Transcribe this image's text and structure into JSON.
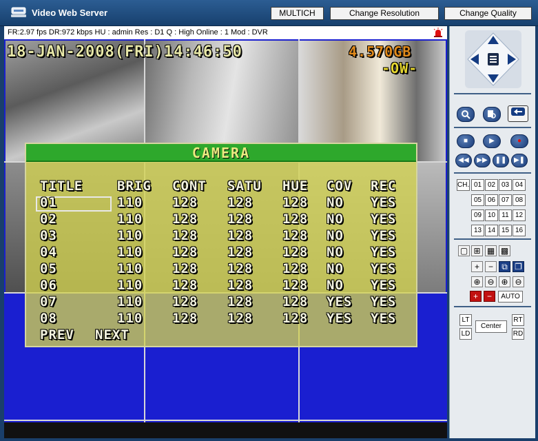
{
  "app": {
    "title": "Video Web Server"
  },
  "toolbar": {
    "multich_label": "MULTICH",
    "resolution_label": "Change Resolution",
    "quality_label": "Change Quality"
  },
  "status": {
    "text": "FR:2.97 fps  DR:972 kbps  HU : admin  Res : D1  Q : High  Online : 1 Mod : DVR"
  },
  "osd": {
    "datetime": "18-JAN-2008(FRI)14:46:50",
    "disk": "4.570GB",
    "mode": "-OW-"
  },
  "camera_menu": {
    "title": "CAMERA",
    "headers": [
      "TITLE",
      "BRIG",
      "CONT",
      "SATU",
      "HUE",
      "COV",
      "REC"
    ],
    "rows": [
      [
        "01",
        "110",
        "128",
        "128",
        "128",
        "NO",
        "YES"
      ],
      [
        "02",
        "110",
        "128",
        "128",
        "128",
        "NO",
        "YES"
      ],
      [
        "03",
        "110",
        "128",
        "128",
        "128",
        "NO",
        "YES"
      ],
      [
        "04",
        "110",
        "128",
        "128",
        "128",
        "NO",
        "YES"
      ],
      [
        "05",
        "110",
        "128",
        "128",
        "128",
        "NO",
        "YES"
      ],
      [
        "06",
        "110",
        "128",
        "128",
        "128",
        "NO",
        "YES"
      ],
      [
        "07",
        "110",
        "128",
        "128",
        "128",
        "YES",
        "YES"
      ],
      [
        "08",
        "110",
        "128",
        "128",
        "128",
        "YES",
        "YES"
      ]
    ],
    "prev_label": "PREV",
    "next_label": "NEXT"
  },
  "channels": {
    "ch_label": "CH.",
    "numbers": [
      "01",
      "02",
      "03",
      "04",
      "05",
      "06",
      "07",
      "08",
      "09",
      "10",
      "11",
      "12",
      "13",
      "14",
      "15",
      "16"
    ]
  },
  "ptz": {
    "auto_label": "AUTO",
    "lt": "LT",
    "ld": "LD",
    "center": "Center",
    "rt": "RT",
    "rd": "RD"
  },
  "colors": {
    "menu_header": "#2ea82c",
    "video_bg": "#1a1fd0",
    "panel_bg": "#e7ebef",
    "titlebar": "#17406e"
  }
}
